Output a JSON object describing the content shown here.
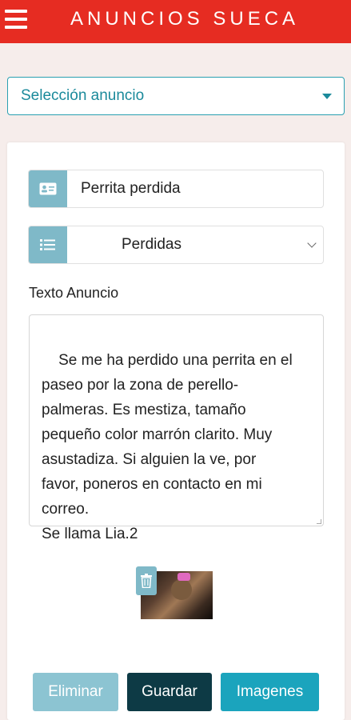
{
  "header": {
    "title": "ANUNCIOS SUECA",
    "accent_color": "#e62c22",
    "menu_icon": "hamburger-menu-icon"
  },
  "ad_selector": {
    "label": "Selección anuncio",
    "icon": "chevron-down-icon"
  },
  "form": {
    "title_value": "Perrita perdida",
    "title_icon": "id-card-icon",
    "category_value": "Perdidas",
    "category_icon": "list-icon",
    "text_label": "Texto Anuncio",
    "text_value": "Se me ha perdido una perrita en el\npaseo por la zona de perello-\npalmeras. Es mestiza, tamaño\npequeño color marrón clarito. Muy\nasustadiza. Si alguien la ve, por\nfavor, poneros en contacto en mi\ncorreo.\nSe llama Lia.2"
  },
  "image": {
    "delete_icon": "trash-icon"
  },
  "actions": {
    "delete_label": "Eliminar",
    "save_label": "Guardar",
    "images_label": "Imagenes"
  }
}
